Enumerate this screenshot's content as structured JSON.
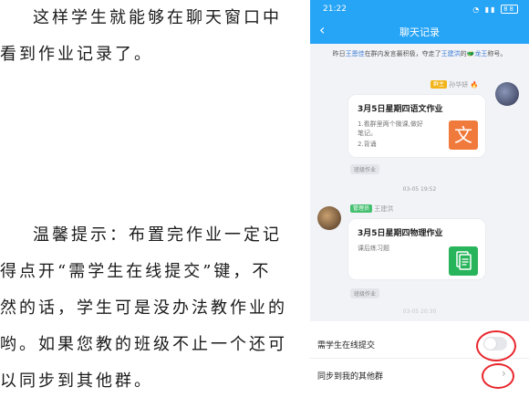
{
  "document": {
    "paragraph1": [
      "这样学生就能够在聊天窗口中",
      "看到作业记录了。"
    ],
    "paragraph2": [
      "温馨提示：布置完作业一定记",
      "得点开“需学生在线提交”键，不",
      "然的话，学生可是没办法教作业的",
      "哟。如果您教的班级不止一个还可",
      "以同步到其他群。"
    ]
  },
  "phone": {
    "status": {
      "time": "21:22",
      "battery": "88"
    },
    "nav": {
      "back": "‹",
      "title": "聊天记录"
    },
    "notice": {
      "prefix": "昨日",
      "name1": "王恩佳",
      "middle": "在群内发言最积极，夺走了",
      "name2": "王建洪",
      "suffix": "的",
      "crown": "龙王",
      "end": "称号。"
    },
    "message1": {
      "badge": "群主",
      "sender": "孙华妍",
      "title": "3月5日星期四语文作业",
      "lines": [
        "1.看群里两个微课,做好",
        "笔记。",
        "2.背诵"
      ],
      "icon_char": "文",
      "tag": "班级作业"
    },
    "time1": "03-05 19:52",
    "message2": {
      "badge": "管理员",
      "sender": "王建洪",
      "title": "3月5日星期四物理作业",
      "lines": [
        "课后练习题"
      ],
      "icon": "document-icon",
      "tag": "班级作业"
    },
    "time2": "03-05 20:30",
    "settings": {
      "row1_label": "需学生在线提交",
      "row2_label": "同步到我的其他群",
      "row2_chevron": "›"
    }
  },
  "colors": {
    "brand": "#26a4f6",
    "highlight": "#e8262c",
    "doc_icon": "#27b45a",
    "chinese_icon": "#f07a3c"
  }
}
